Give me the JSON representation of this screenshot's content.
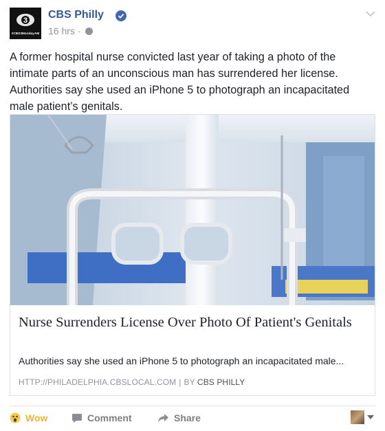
{
  "post": {
    "page_name": "CBS Philly",
    "avatar_tag": "#CBS3MondayAM",
    "time": "16 hrs",
    "time_sep": "·",
    "text": "A former hospital nurse convicted last year of taking a photo of the intimate parts of an unconscious man has surrendered her license. Authorities say she used an iPhone 5 to photograph an incapacitated male patient’s genitals."
  },
  "link": {
    "title": "Nurse Surrenders License Over Photo Of Patient's Genitals",
    "description": "Authorities say she used an iPhone 5 to photograph an incapacitated male...",
    "domain": "HTTP://PHILADELPHIA.CBSLOCAL.COM",
    "separator": "|",
    "by_label": "BY",
    "author": "CBS PHILLY"
  },
  "actions": {
    "wow_label": "Wow",
    "comment_label": "Comment",
    "share_label": "Share"
  },
  "colors": {
    "brand_blue": "#365899",
    "verified": "#4267b2",
    "wow": "#e9b632",
    "muted": "#90949c"
  },
  "icons": [
    "verified-badge-icon",
    "globe-icon",
    "chevron-down-icon",
    "wow-emoji-icon",
    "comment-icon",
    "share-arrow-icon",
    "caret-down-icon"
  ]
}
